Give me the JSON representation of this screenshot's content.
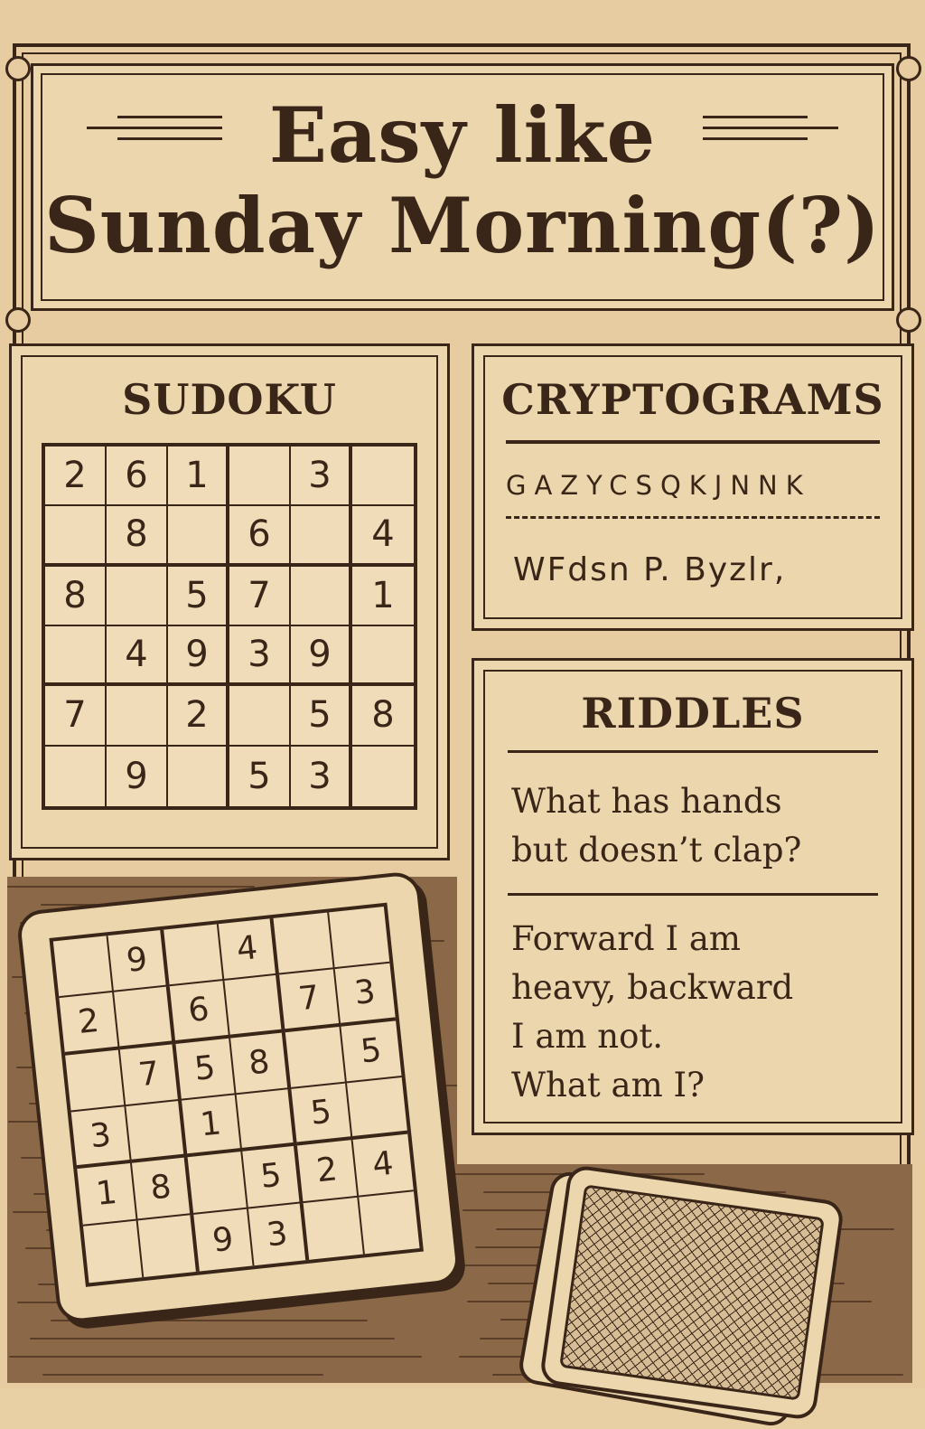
{
  "title": {
    "line1": "Easy like",
    "line2": "Sunday Morning(?)"
  },
  "sudoku": {
    "heading": "SUDOKU",
    "grid": [
      [
        "2",
        "6",
        "1",
        "",
        "3",
        ""
      ],
      [
        "",
        "8",
        "",
        "6",
        "",
        "4"
      ],
      [
        "8",
        "",
        "5",
        "7",
        "",
        "1"
      ],
      [
        "",
        "4",
        "9",
        "3",
        "9",
        ""
      ],
      [
        "7",
        "",
        "2",
        "",
        "5",
        "8"
      ],
      [
        "",
        "9",
        "",
        "5",
        "3",
        ""
      ]
    ]
  },
  "cryptograms": {
    "heading": "CRYPTOGRAMS",
    "letters": "GAZYCSQKJNNK",
    "cipher": "WFdsn P. Byzlr,"
  },
  "riddles": {
    "heading": "RIDDLES",
    "riddle1_line1": "What has hands",
    "riddle1_line2": "but doesn’t clap?",
    "riddle2_line1": "Forward I am",
    "riddle2_line2": "heavy, backward",
    "riddle2_line3": "I am not.",
    "riddle2_line4": "What am I?"
  },
  "tilted_board": {
    "grid": [
      [
        "",
        "9",
        "",
        "4",
        "",
        ""
      ],
      [
        "2",
        "",
        "6",
        "",
        "7",
        "3"
      ],
      [
        "",
        "7",
        "5",
        "8",
        "",
        "5"
      ],
      [
        "3",
        "",
        "1",
        "",
        "5",
        ""
      ],
      [
        "1",
        "8",
        "",
        "5",
        "2",
        "4"
      ],
      [
        "",
        "",
        "9",
        "3",
        "",
        ""
      ]
    ]
  },
  "colors": {
    "ink": "#3a2618",
    "paper": "#e6cca0",
    "wood": "#8a6848"
  }
}
